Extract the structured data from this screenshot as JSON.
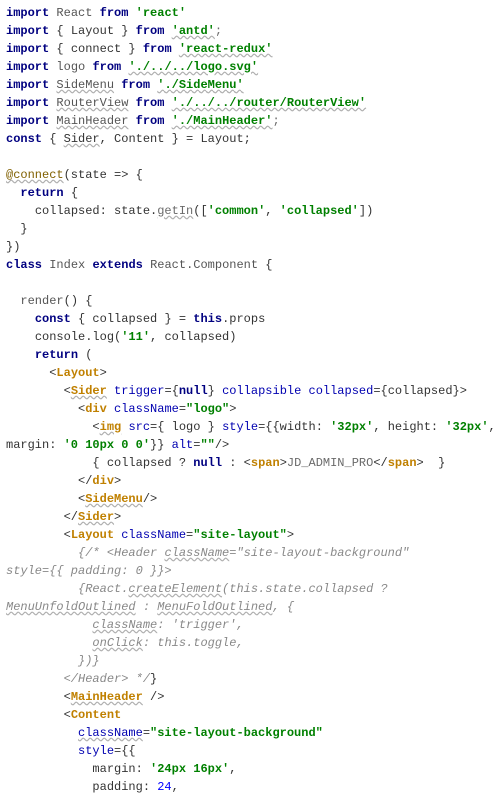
{
  "file": "Index.jsx",
  "language": "javascript-react",
  "imports": [
    {
      "clause": "React",
      "from": "react"
    },
    {
      "clause": "{ Layout }",
      "from": "antd"
    },
    {
      "clause": "{ connect }",
      "from": "react-redux"
    },
    {
      "clause": "logo",
      "from": "./../../logo.svg"
    },
    {
      "clause": "SideMenu",
      "from": "./SideMenu"
    },
    {
      "clause": "RouterView",
      "from": "./../../router/RouterView"
    },
    {
      "clause": "MainHeader",
      "from": "./MainHeader"
    }
  ],
  "destructure": "const { Sider, Content } = Layout;",
  "connect_body": "collapsed: state.getIn(['common', 'collapsed'])",
  "class_decl": "class Index extends React.Component {",
  "render_destructure": "const { collapsed } = this.props",
  "console_log": "console.log('11', collapsed)",
  "logo_style": "{width: '32px', height: '32px', margin: '0 10px 0 0'}",
  "logo_alt": "",
  "admin_title": "JD_ADMIN_PRO",
  "layout_className": "site-layout",
  "header_className": "site-layout-background",
  "header_style": "{ padding: 0 }",
  "trigger_className": "trigger",
  "content_className": "site-layout-background",
  "content_style": {
    "margin": "24px 16px",
    "padding": 24
  }
}
